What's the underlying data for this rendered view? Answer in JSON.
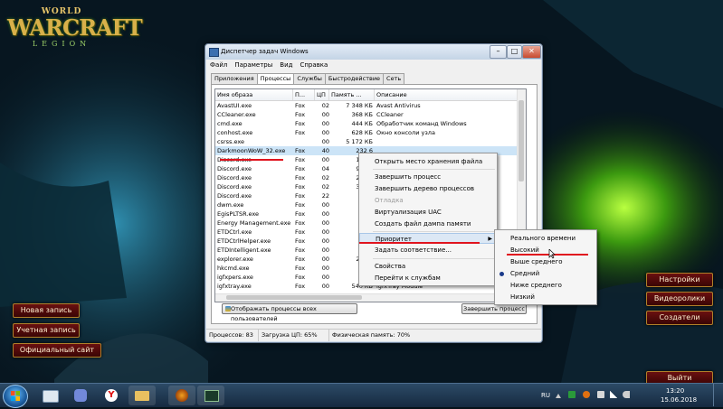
{
  "desktop": {
    "logo": {
      "line1": "WORLD",
      "line2": "WARCRAFT",
      "line3": "LEGION"
    },
    "left_buttons": [
      "Новая запись",
      "Учетная запись",
      "Официальный сайт"
    ],
    "right_buttons": [
      "Настройки",
      "Видеоролики",
      "Создатели"
    ],
    "exit_button": "Выйти"
  },
  "window": {
    "title": "Диспетчер задач Windows",
    "controls": {
      "minimize": "–",
      "maximize": "□",
      "close": "✕"
    },
    "menu": [
      "Файл",
      "Параметры",
      "Вид",
      "Справка"
    ],
    "tabs": [
      "Приложения",
      "Процессы",
      "Службы",
      "Быстродействие",
      "Сеть"
    ],
    "columns": [
      "Имя образа",
      "П...",
      "ЦП",
      "Память ...",
      "Описание"
    ],
    "rows": [
      {
        "name": "AvastUI.exe",
        "user": "Fox",
        "cpu": "02",
        "mem": "7 348 КБ",
        "desc": "Avast Antivirus"
      },
      {
        "name": "CCleaner.exe",
        "user": "Fox",
        "cpu": "00",
        "mem": "368 КБ",
        "desc": "CCleaner"
      },
      {
        "name": "cmd.exe",
        "user": "Fox",
        "cpu": "00",
        "mem": "444 КБ",
        "desc": "Обработчик команд Windows"
      },
      {
        "name": "conhost.exe",
        "user": "Fox",
        "cpu": "00",
        "mem": "628 КБ",
        "desc": "Окно консоли узла"
      },
      {
        "name": "csrss.exe",
        "user": "",
        "cpu": "00",
        "mem": "5 172 КБ",
        "desc": ""
      },
      {
        "name": "DarkmoonWoW_32.exe",
        "user": "Fox",
        "cpu": "40",
        "mem": "232 6",
        "desc": ""
      },
      {
        "name": "Discord.exe",
        "user": "Fox",
        "cpu": "00",
        "mem": "12 56",
        "desc": ""
      },
      {
        "name": "Discord.exe",
        "user": "Fox",
        "cpu": "04",
        "mem": "94 63",
        "desc": ""
      },
      {
        "name": "Discord.exe",
        "user": "Fox",
        "cpu": "02",
        "mem": "20 66",
        "desc": ""
      },
      {
        "name": "Discord.exe",
        "user": "Fox",
        "cpu": "02",
        "mem": "34 93",
        "desc": ""
      },
      {
        "name": "Discord.exe",
        "user": "Fox",
        "cpu": "22",
        "mem": "9 96",
        "desc": ""
      },
      {
        "name": "dwm.exe",
        "user": "Fox",
        "cpu": "00",
        "mem": "1 20",
        "desc": ""
      },
      {
        "name": "EgisPLTSR.exe",
        "user": "Fox",
        "cpu": "00",
        "mem": "1 20",
        "desc": ""
      },
      {
        "name": "Energy Management.exe",
        "user": "Fox",
        "cpu": "00",
        "mem": "1 95",
        "desc": ""
      },
      {
        "name": "ETDCtrl.exe",
        "user": "Fox",
        "cpu": "00",
        "mem": "3 34",
        "desc": ""
      },
      {
        "name": "ETDCtrlHelper.exe",
        "user": "Fox",
        "cpu": "00",
        "mem": "70",
        "desc": ""
      },
      {
        "name": "ETDIntelligent.exe",
        "user": "Fox",
        "cpu": "00",
        "mem": "90",
        "desc": ""
      },
      {
        "name": "explorer.exe",
        "user": "Fox",
        "cpu": "00",
        "mem": "27 20",
        "desc": ""
      },
      {
        "name": "hkcmd.exe",
        "user": "Fox",
        "cpu": "00",
        "mem": "61",
        "desc": ""
      },
      {
        "name": "igfxpers.exe",
        "user": "Fox",
        "cpu": "00",
        "mem": "1 22",
        "desc": ""
      },
      {
        "name": "igfxtray.exe",
        "user": "Fox",
        "cpu": "00",
        "mem": "540 КБ",
        "desc": "igfxTray Module"
      }
    ],
    "show_all_label": "Отображать процессы всех пользователей",
    "end_process_label": "Завершить процесс",
    "status": {
      "processes": "Процессов: 83",
      "cpu": "Загрузка ЦП: 65%",
      "memory": "Физическая память: 70%"
    }
  },
  "context_menu": [
    {
      "label": "Открыть место хранения файла",
      "disabled": false
    },
    {
      "label": "Завершить процесс",
      "disabled": false
    },
    {
      "label": "Завершить дерево процессов",
      "disabled": false
    },
    {
      "label": "Отладка",
      "disabled": true
    },
    {
      "label": "Виртуализация UAC",
      "disabled": false
    },
    {
      "label": "Создать файл дампа памяти",
      "disabled": false
    },
    {
      "label": "Приоритет",
      "disabled": false
    },
    {
      "label": "Задать соответствие...",
      "disabled": false
    },
    {
      "label": "Свойства",
      "disabled": false
    },
    {
      "label": "Перейти к службам",
      "disabled": false
    }
  ],
  "priority_menu": [
    "Реального времени",
    "Высокий",
    "Выше среднего",
    "Средний",
    "Ниже среднего",
    "Низкий"
  ],
  "taskbar": {
    "lang": "RU",
    "time": "13:20",
    "date": "15.06.2018"
  },
  "colors": {
    "accent_red": "#e0141e",
    "selection": "#cce4f7",
    "taskbar": "#1e3a55"
  }
}
